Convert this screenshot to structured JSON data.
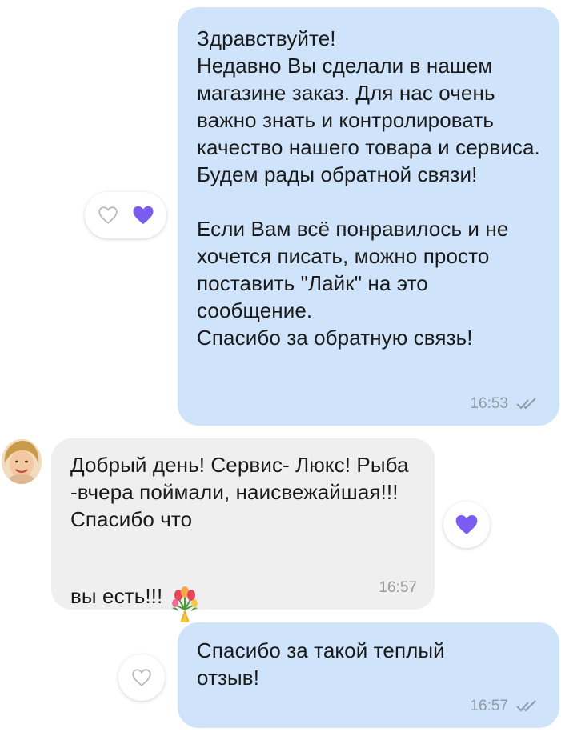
{
  "messages": [
    {
      "direction": "outgoing",
      "text": "Здравствуйте!\nНедавно Вы сделали в нашем магазине заказ. Для нас очень важно знать и контролировать качество нашего товара и сервиса. Будем рады обратной связи!\n\nЕсли Вам всё понравилось и не хочется писать, можно просто поставить \"Лайк\" на это сообщение.\nСпасибо за обратную связь!",
      "time": "16:53",
      "status": "read"
    },
    {
      "direction": "incoming",
      "text_main": "Добрый день! Сервис- Люкс! Рыба -вчера поймали, наисвежайшая!!! Спасибо  что",
      "text_last": "вы есть!!!",
      "emoji": "bouquet",
      "time": "16:57",
      "reaction": "liked"
    },
    {
      "direction": "outgoing",
      "text": "Спасибо за такой теплый отзыв!",
      "time": "16:57",
      "status": "read"
    }
  ],
  "colors": {
    "outgoing_bubble": "#cfe4fb",
    "incoming_bubble": "#efefef",
    "heart_filled": "#7a5cf0",
    "heart_outline": "#b8b8b8",
    "meta_text": "#8e9aa6"
  },
  "icons": {
    "reaction_outline": "heart-outline-icon",
    "reaction_filled": "heart-filled-icon",
    "read_status": "double-check-icon",
    "emoji": "bouquet-emoji-icon"
  }
}
